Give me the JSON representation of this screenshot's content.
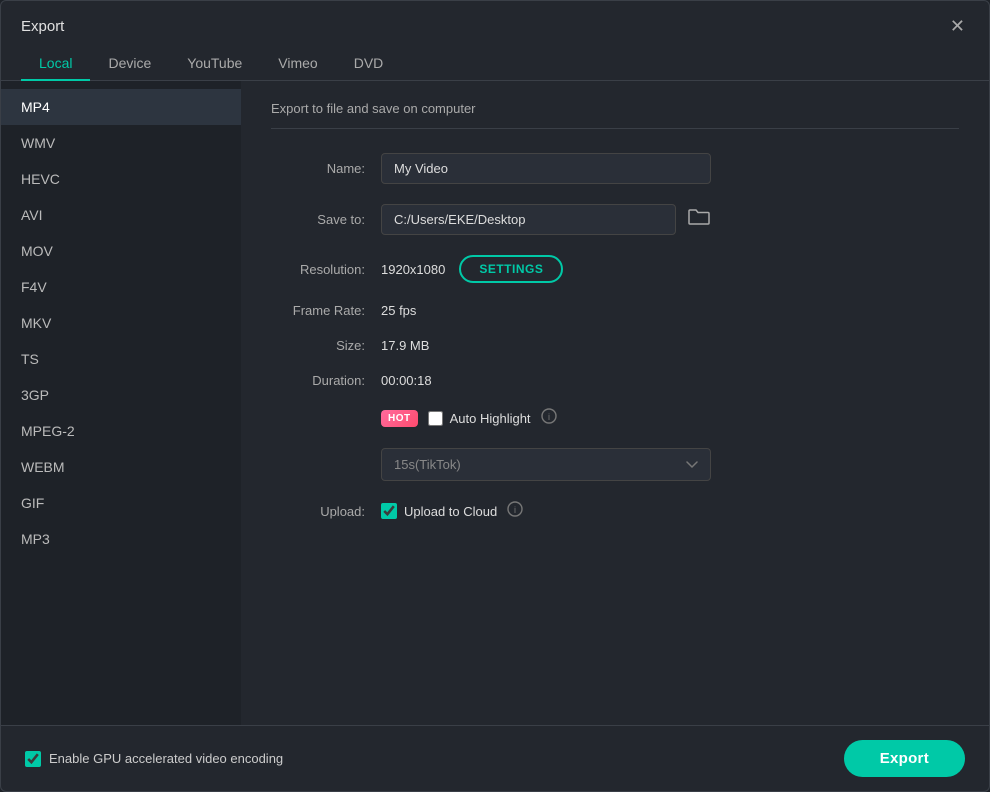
{
  "dialog": {
    "title": "Export"
  },
  "tabs": [
    {
      "id": "local",
      "label": "Local",
      "active": true
    },
    {
      "id": "device",
      "label": "Device",
      "active": false
    },
    {
      "id": "youtube",
      "label": "YouTube",
      "active": false
    },
    {
      "id": "vimeo",
      "label": "Vimeo",
      "active": false
    },
    {
      "id": "dvd",
      "label": "DVD",
      "active": false
    }
  ],
  "formats": [
    {
      "id": "mp4",
      "label": "MP4",
      "active": true
    },
    {
      "id": "wmv",
      "label": "WMV",
      "active": false
    },
    {
      "id": "hevc",
      "label": "HEVC",
      "active": false
    },
    {
      "id": "avi",
      "label": "AVI",
      "active": false
    },
    {
      "id": "mov",
      "label": "MOV",
      "active": false
    },
    {
      "id": "f4v",
      "label": "F4V",
      "active": false
    },
    {
      "id": "mkv",
      "label": "MKV",
      "active": false
    },
    {
      "id": "ts",
      "label": "TS",
      "active": false
    },
    {
      "id": "3gp",
      "label": "3GP",
      "active": false
    },
    {
      "id": "mpeg2",
      "label": "MPEG-2",
      "active": false
    },
    {
      "id": "webm",
      "label": "WEBM",
      "active": false
    },
    {
      "id": "gif",
      "label": "GIF",
      "active": false
    },
    {
      "id": "mp3",
      "label": "MP3",
      "active": false
    }
  ],
  "panel": {
    "description": "Export to file and save on computer",
    "name_label": "Name:",
    "name_value": "My Video",
    "save_to_label": "Save to:",
    "save_to_value": "C:/Users/EKE/Desktop",
    "resolution_label": "Resolution:",
    "resolution_value": "1920x1080",
    "settings_button": "SETTINGS",
    "frame_rate_label": "Frame Rate:",
    "frame_rate_value": "25 fps",
    "size_label": "Size:",
    "size_value": "17.9 MB",
    "duration_label": "Duration:",
    "duration_value": "00:00:18",
    "hot_badge": "HOT",
    "auto_highlight_label": "Auto Highlight",
    "tiktok_option": "15s(TikTok)",
    "upload_label": "Upload:",
    "upload_to_cloud_label": "Upload to Cloud",
    "gpu_label": "Enable GPU accelerated video encoding",
    "export_button": "Export"
  },
  "icons": {
    "close": "✕",
    "folder": "🗁",
    "info": "?"
  }
}
